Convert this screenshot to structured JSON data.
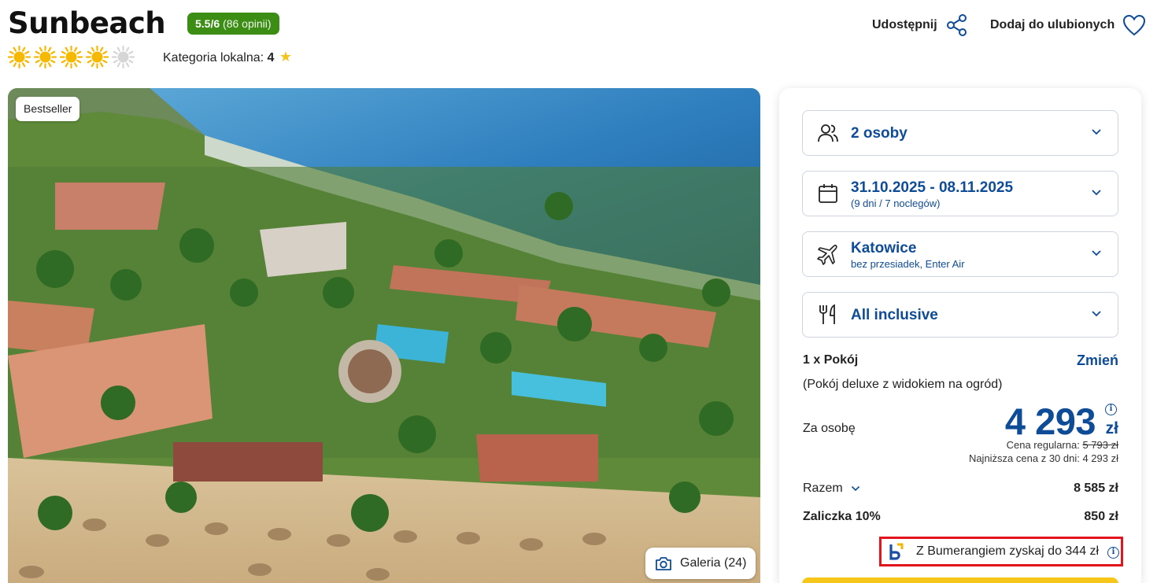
{
  "header": {
    "title": "Sunbeach",
    "rating_score": "5.5/6",
    "rating_count": "(86 opinii)",
    "sun_rating": 4,
    "sun_max": 5,
    "local_category_label": "Kategoria lokalna:",
    "local_category_value": "4",
    "share_label": "Udostępnij",
    "favorite_label": "Dodaj do ulubionych"
  },
  "gallery": {
    "badge": "Bestseller",
    "button_label": "Galeria (24)"
  },
  "booking": {
    "travelers": "2 osoby",
    "dates": "31.10.2025 - 08.11.2025",
    "dates_sub": "(9 dni / 7 noclegów)",
    "departure": "Katowice",
    "departure_sub": "bez przesiadek, Enter Air",
    "board": "All inclusive",
    "room_count": "1 x Pokój",
    "room_change": "Zmień",
    "room_desc": "(Pokój deluxe z widokiem na ogród)",
    "per_person_label": "Za osobę",
    "price": "4 293",
    "currency": "zł",
    "regular_label": "Cena regularna:",
    "regular_price": "5 793 zł",
    "lowest_30": "Najniższa cena z 30 dni: 4 293 zł",
    "total_label": "Razem",
    "total_value": "8 585 zł",
    "deposit_label": "Zaliczka 10%",
    "deposit_value": "850 zł",
    "boomerang_text": "Z Bumerangiem zyskaj do 344 zł"
  },
  "colors": {
    "brand_blue": "#0f4c97",
    "rating_green": "#3b8d14",
    "sun_yellow": "#f6b800",
    "highlight_red": "#e3141c",
    "cta_yellow": "#f7c61a"
  }
}
